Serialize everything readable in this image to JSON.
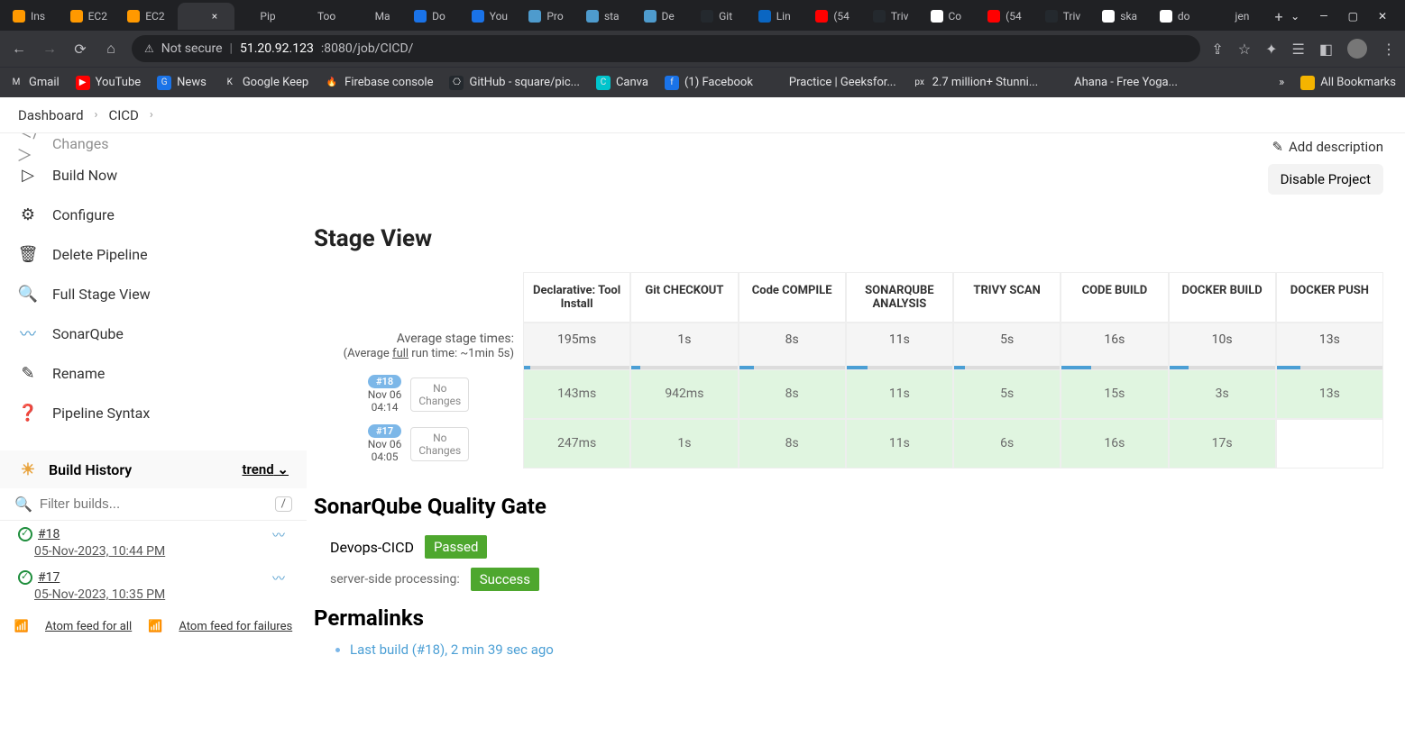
{
  "browser": {
    "tabs": [
      {
        "label": "Ins"
      },
      {
        "label": "EC2"
      },
      {
        "label": "EC2"
      },
      {
        "label": "",
        "x": "×"
      },
      {
        "label": "Pip"
      },
      {
        "label": "Too"
      },
      {
        "label": "Ma"
      },
      {
        "label": "Do"
      },
      {
        "label": "You"
      },
      {
        "label": "Pro"
      },
      {
        "label": "sta"
      },
      {
        "label": "De"
      },
      {
        "label": "Git"
      },
      {
        "label": "Lin"
      },
      {
        "label": "(54"
      },
      {
        "label": "Triv"
      },
      {
        "label": "Co"
      },
      {
        "label": "(54"
      },
      {
        "label": "Triv"
      },
      {
        "label": "ska"
      },
      {
        "label": "do"
      },
      {
        "label": "jen"
      }
    ],
    "url_insecure": "Not secure",
    "url_host": "51.20.92.123",
    "url_path": ":8080/job/CICD/",
    "wincontrols": {
      "drop": "⌄",
      "min": "—",
      "max": "▢",
      "close": "✕"
    },
    "bookmarks": [
      {
        "label": "Gmail"
      },
      {
        "label": "YouTube"
      },
      {
        "label": "News"
      },
      {
        "label": "Google Keep"
      },
      {
        "label": "Firebase console"
      },
      {
        "label": "GitHub - square/pic..."
      },
      {
        "label": "Canva"
      },
      {
        "label": "(1) Facebook"
      },
      {
        "label": "Practice | Geeksfor..."
      },
      {
        "label": "2.7 million+ Stunni..."
      },
      {
        "label": "Ahana - Free Yoga..."
      }
    ],
    "all_bookmarks": "All Bookmarks"
  },
  "breadcrumbs": {
    "dashboard": "Dashboard",
    "job": "CICD"
  },
  "sidebar": {
    "changes": "Changes",
    "buildnow": "Build Now",
    "configure": "Configure",
    "delete": "Delete Pipeline",
    "fullstage": "Full Stage View",
    "sonar": "SonarQube",
    "rename": "Rename",
    "syntax": "Pipeline Syntax",
    "buildhistory": "Build History",
    "trend": "trend",
    "filter_placeholder": "Filter builds...",
    "builds": [
      {
        "num": "#18",
        "date": "05-Nov-2023, 10:44 PM"
      },
      {
        "num": "#17",
        "date": "05-Nov-2023, 10:35 PM"
      }
    ],
    "atom_all": "Atom feed for all",
    "atom_fail": "Atom feed for failures"
  },
  "main_actions": {
    "add_desc": "Add description",
    "disable": "Disable Project"
  },
  "stage_view": {
    "title": "Stage View",
    "avg_label": "Average stage times:",
    "avg_sub_a": "(Average ",
    "avg_sub_u": "full",
    "avg_sub_b": " run time: ~1min 5s)",
    "columns": [
      "Declarative: Tool Install",
      "Git CHECKOUT",
      "Code COMPILE",
      "SONARQUBE ANALYSIS",
      "TRIVY SCAN",
      "CODE BUILD",
      "DOCKER BUILD",
      "DOCKER PUSH"
    ],
    "avgs": [
      "195ms",
      "1s",
      "8s",
      "11s",
      "5s",
      "16s",
      "10s",
      "13s"
    ],
    "avg_fill": [
      6,
      8,
      14,
      20,
      10,
      28,
      18,
      22
    ],
    "runs": [
      {
        "badge": "#18",
        "date": "Nov 06",
        "time": "04:14",
        "nochanges": "No Changes",
        "cells": [
          "143ms",
          "942ms",
          "8s",
          "11s",
          "5s",
          "15s",
          "3s",
          "13s"
        ],
        "empty": []
      },
      {
        "badge": "#17",
        "date": "Nov 06",
        "time": "04:05",
        "nochanges": "No Changes",
        "cells": [
          "247ms",
          "1s",
          "8s",
          "11s",
          "6s",
          "16s",
          "17s",
          ""
        ],
        "empty": [
          7
        ]
      }
    ]
  },
  "sonar_gate": {
    "title": "SonarQube Quality Gate",
    "project": "Devops-CICD",
    "passed": "Passed",
    "server_label": "server-side processing:",
    "success": "Success"
  },
  "permalinks": {
    "title": "Permalinks",
    "last": "Last build (#18), 2 min 39 sec ago"
  }
}
